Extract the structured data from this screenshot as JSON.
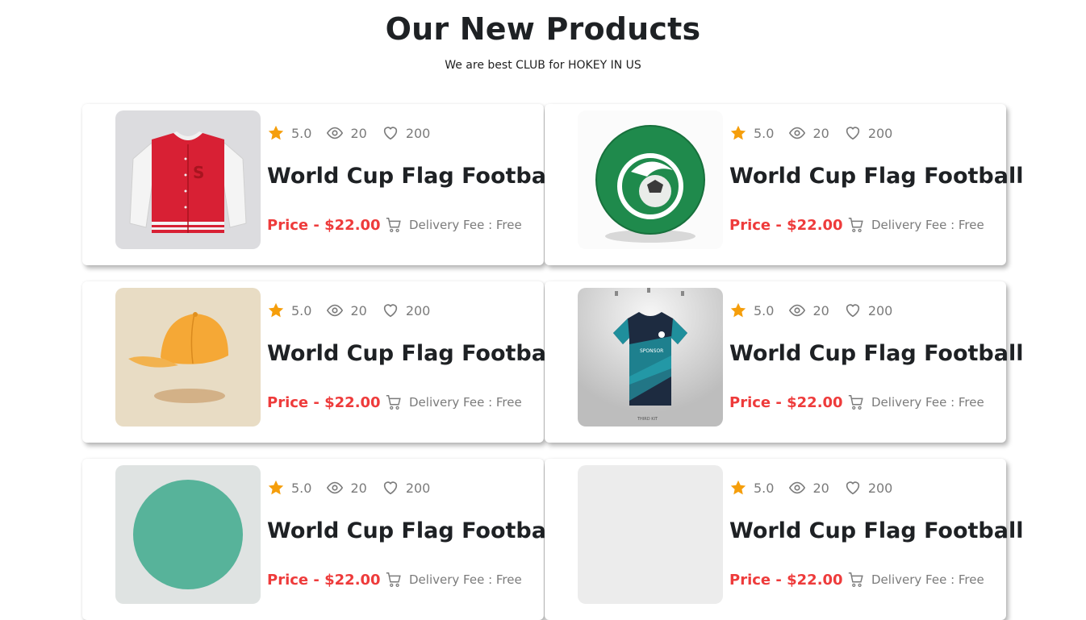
{
  "header": {
    "title": "Our New Products",
    "subtitle": "We are best CLUB for HOKEY IN US"
  },
  "colors": {
    "accent_price": "#ee3b3b",
    "star": "#f59e0b",
    "text_muted": "#7b7b7b",
    "heading": "#1e2124"
  },
  "products": [
    {
      "image": "red-varsity-jacket",
      "rating": "5.0",
      "views": "20",
      "likes": "200",
      "name": "World Cup Flag Football",
      "price": "Price - $22.00",
      "delivery": "Delivery Fee : Free"
    },
    {
      "image": "green-football",
      "rating": "5.0",
      "views": "20",
      "likes": "200",
      "name": "World Cup Flag Football",
      "price": "Price - $22.00",
      "delivery": "Delivery Fee : Free"
    },
    {
      "image": "orange-cap",
      "rating": "5.0",
      "views": "20",
      "likes": "200",
      "name": "World Cup Flag Football",
      "price": "Price - $22.00",
      "delivery": "Delivery Fee : Free"
    },
    {
      "image": "teal-jersey",
      "rating": "5.0",
      "views": "20",
      "likes": "200",
      "name": "World Cup Flag Football",
      "price": "Price - $22.00",
      "delivery": "Delivery Fee : Free"
    },
    {
      "image": "teal-ball",
      "rating": "5.0",
      "views": "20",
      "likes": "200",
      "name": "World Cup Flag Football",
      "price": "Price - $22.00",
      "delivery": "Delivery Fee : Free"
    },
    {
      "image": "grey-product",
      "rating": "5.0",
      "views": "20",
      "likes": "200",
      "name": "World Cup Flag Football",
      "price": "Price - $22.00",
      "delivery": "Delivery Fee : Free"
    }
  ]
}
